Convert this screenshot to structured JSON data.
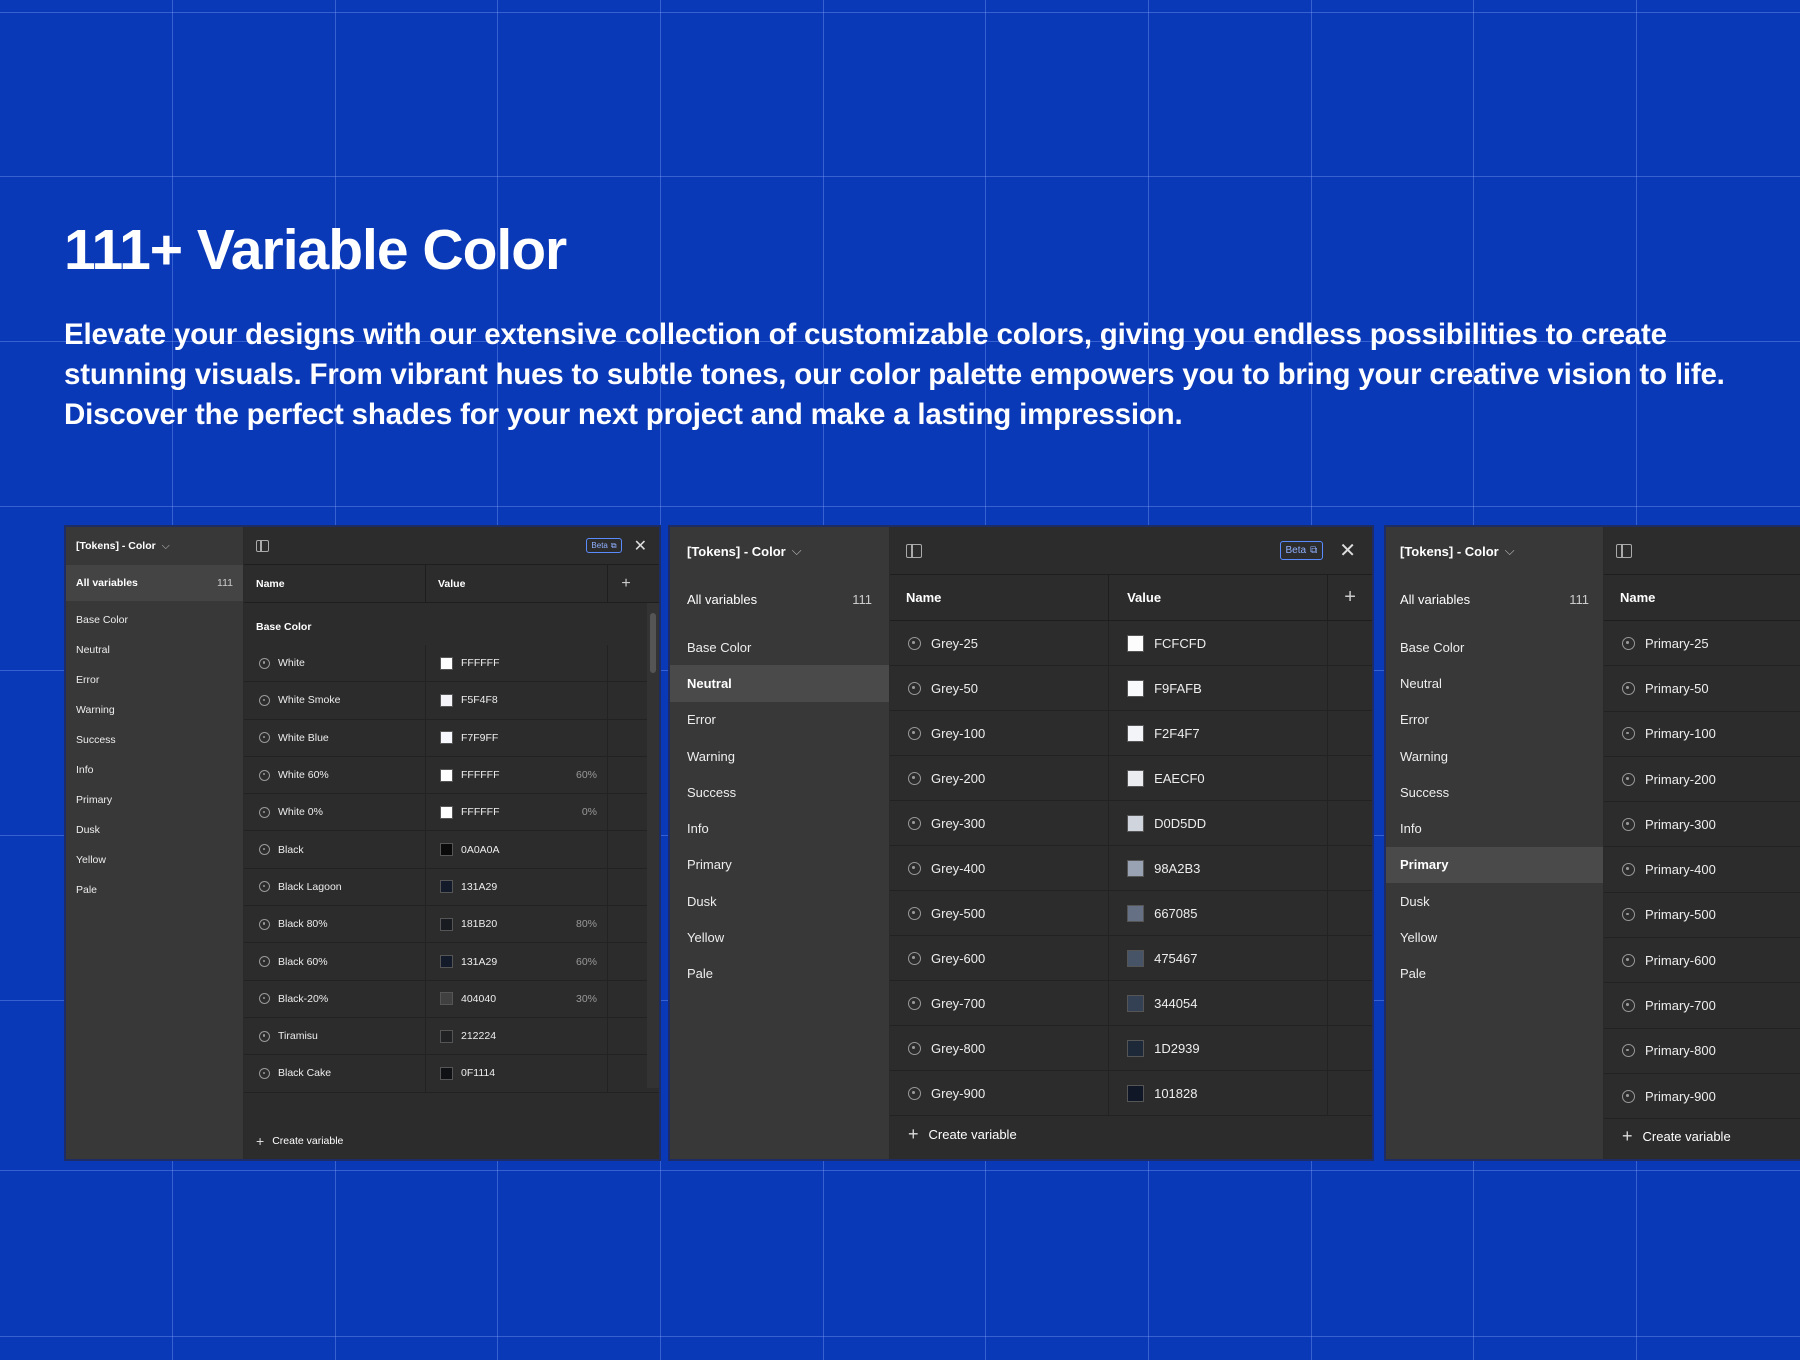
{
  "hero": {
    "title": "111+ Variable Color",
    "description": "Elevate your designs with our extensive collection of customizable colors, giving you endless possibilities to create stunning visuals. From vibrant hues to subtle tones, our color palette empowers you to bring your creative vision to life. Discover the perfect shades for your next project and make a lasting impression."
  },
  "colors": {
    "background": "#0A39B8",
    "panel": "#2C2C2C",
    "sidebar": "#383838",
    "accent": "#5A8CFF"
  },
  "common": {
    "collection": "[Tokens] - Color",
    "chevron": "⌵",
    "all_variables": "All variables",
    "count": "111",
    "col_name": "Name",
    "col_value": "Value",
    "add": "+",
    "beta": "Beta",
    "beta_icon": "⧉",
    "close": "✕",
    "create_variable": "Create variable",
    "icons": {
      "sidebar": "sidebar-toggle-icon",
      "variable": "color-variable-icon",
      "external": "external-link-icon"
    }
  },
  "sidebar_groups": [
    "Base Color",
    "Neutral",
    "Error",
    "Warning",
    "Success",
    "Info",
    "Primary",
    "Dusk",
    "Yellow",
    "Pale"
  ],
  "panel1": {
    "group_label": "Base Color",
    "rows": [
      {
        "name": "White",
        "value": "FFFFFF",
        "opacity": "",
        "swatch": "#FFFFFF"
      },
      {
        "name": "White Smoke",
        "value": "F5F4F8",
        "opacity": "",
        "swatch": "#F5F4F8"
      },
      {
        "name": "White Blue",
        "value": "F7F9FF",
        "opacity": "",
        "swatch": "#F7F9FF"
      },
      {
        "name": "White 60%",
        "value": "FFFFFF",
        "opacity": "60%",
        "swatch": "#FFFFFF"
      },
      {
        "name": "White 0%",
        "value": "FFFFFF",
        "opacity": "0%",
        "swatch": "#FFFFFF"
      },
      {
        "name": "Black",
        "value": "0A0A0A",
        "opacity": "",
        "swatch": "#0A0A0A"
      },
      {
        "name": "Black Lagoon",
        "value": "131A29",
        "opacity": "",
        "swatch": "#131A29"
      },
      {
        "name": "Black 80%",
        "value": "181B20",
        "opacity": "80%",
        "swatch": "#181B20"
      },
      {
        "name": "Black 60%",
        "value": "131A29",
        "opacity": "60%",
        "swatch": "#131A29"
      },
      {
        "name": "Black-20%",
        "value": "404040",
        "opacity": "30%",
        "swatch": "#404040"
      },
      {
        "name": "Tiramisu",
        "value": "212224",
        "opacity": "",
        "swatch": "#212224"
      },
      {
        "name": "Black Cake",
        "value": "0F1114",
        "opacity": "",
        "swatch": "#0F1114"
      }
    ]
  },
  "panel2": {
    "active_group": "Neutral",
    "rows": [
      {
        "name": "Grey-25",
        "value": "FCFCFD",
        "swatch": "#FCFCFD"
      },
      {
        "name": "Grey-50",
        "value": "F9FAFB",
        "swatch": "#F9FAFB"
      },
      {
        "name": "Grey-100",
        "value": "F2F4F7",
        "swatch": "#F2F4F7"
      },
      {
        "name": "Grey-200",
        "value": "EAECF0",
        "swatch": "#EAECF0"
      },
      {
        "name": "Grey-300",
        "value": "D0D5DD",
        "swatch": "#D0D5DD"
      },
      {
        "name": "Grey-400",
        "value": "98A2B3",
        "swatch": "#98A2B3"
      },
      {
        "name": "Grey-500",
        "value": "667085",
        "swatch": "#667085"
      },
      {
        "name": "Grey-600",
        "value": "475467",
        "swatch": "#475467"
      },
      {
        "name": "Grey-700",
        "value": "344054",
        "swatch": "#344054"
      },
      {
        "name": "Grey-800",
        "value": "1D2939",
        "swatch": "#1D2939"
      },
      {
        "name": "Grey-900",
        "value": "101828",
        "swatch": "#101828"
      }
    ]
  },
  "panel3": {
    "active_group": "Primary",
    "rows": [
      "Primary-25",
      "Primary-50",
      "Primary-100",
      "Primary-200",
      "Primary-300",
      "Primary-400",
      "Primary-500",
      "Primary-600",
      "Primary-700",
      "Primary-800",
      "Primary-900"
    ]
  }
}
